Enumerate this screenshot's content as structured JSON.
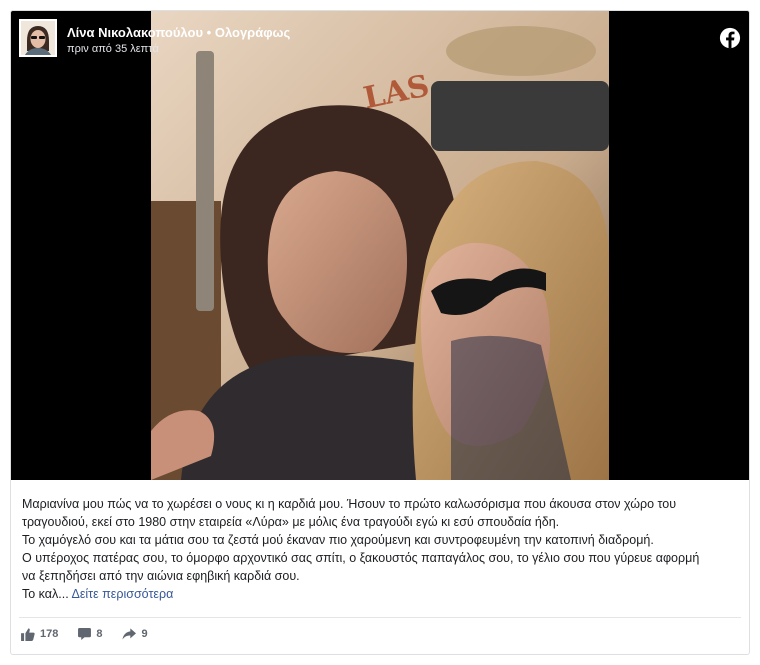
{
  "post": {
    "author": "Λίνα Νικολακοπούλου",
    "separator": "•",
    "post_type": "Ολογράφως",
    "timestamp": "πριν από 35 λεπτά"
  },
  "text": {
    "lines": [
      "Μαριανίνα μου πώς να το χωρέσει ο νους κι η καρδιά μου. Ήσουν το πρώτο καλωσόρισμα που άκουσα στον χώρο του",
      "τραγουδιού, εκεί στο 1980 στην εταιρεία «Λύρα» με μόλις ένα τραγούδι εγώ κι εσύ σπουδαία ήδη.",
      "Το χαμόγελό σου και τα μάτια σου τα ζεστά μού έκαναν πιο χαρούμενη και συντροφευμένη την κατοπινή διαδρομή.",
      "Ο υπέροχος πατέρας σου, το όμορφο αρχοντικό σας σπίτι, ο ξακουστός παπαγάλος σου, το γέλιο σου που γύρευε αφορμή",
      "να ξεπηδήσει από την αιώνια εφηβική καρδιά σου."
    ],
    "truncated": "Το καλ...",
    "see_more": "Δείτε περισσότερα"
  },
  "stats": {
    "likes": "178",
    "comments": "8",
    "shares": "9"
  },
  "photo_overlay_text": "LAS",
  "icons": {
    "facebook": "facebook-logo-icon",
    "like": "thumbs-up-icon",
    "comment": "comment-icon",
    "share": "share-arrow-icon"
  },
  "colors": {
    "link": "#385898",
    "facebook_blue": "#1877f2",
    "meta_text": "#606770",
    "body_text": "#1c1e21"
  }
}
